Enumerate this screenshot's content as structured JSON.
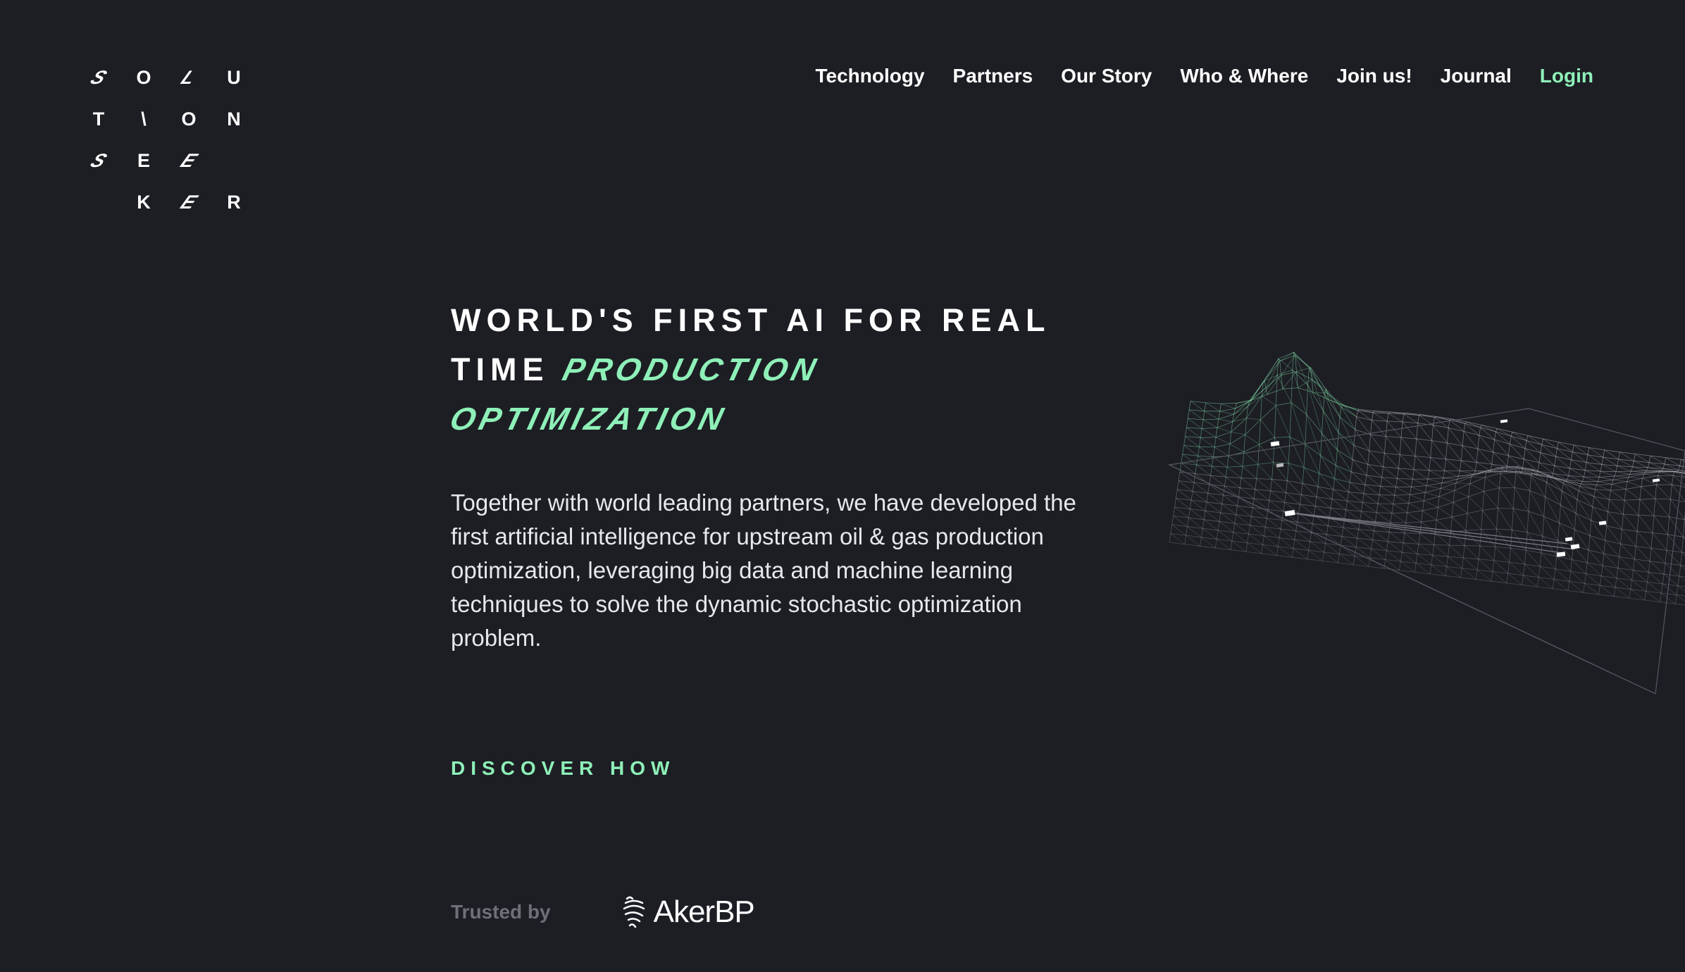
{
  "brand": {
    "logo_letters": [
      "S",
      "O",
      "L",
      "U",
      "T",
      "\\",
      "O",
      "N",
      "S",
      "E",
      "E",
      "",
      "",
      "K",
      "E",
      "R"
    ],
    "logo_italic_flags": [
      true,
      false,
      true,
      false,
      false,
      false,
      false,
      false,
      true,
      false,
      true,
      false,
      false,
      false,
      true,
      false
    ]
  },
  "nav": {
    "items": [
      "Technology",
      "Partners",
      "Our Story",
      "Who & Where",
      "Join us!",
      "Journal"
    ],
    "login": "Login"
  },
  "hero": {
    "headline_line1": "WORLD'S FIRST AI FOR REAL",
    "headline_line2_plain": "TIME",
    "headline_accent_1": "PRODUCTION",
    "headline_accent_2": "OPTIMIZATION",
    "lead": "Together with world leading partners, we have developed the first artificial intelligence for upstream oil & gas production optimization, leveraging big data and machine learning techniques to solve the dynamic stochastic optimization problem.",
    "cta": "DISCOVER HOW"
  },
  "trusted": {
    "label": "Trusted by",
    "partner": "AkerBP"
  },
  "colors": {
    "background": "#1d1e24",
    "accent": "#8ef0b8",
    "muted": "#6f7077"
  }
}
